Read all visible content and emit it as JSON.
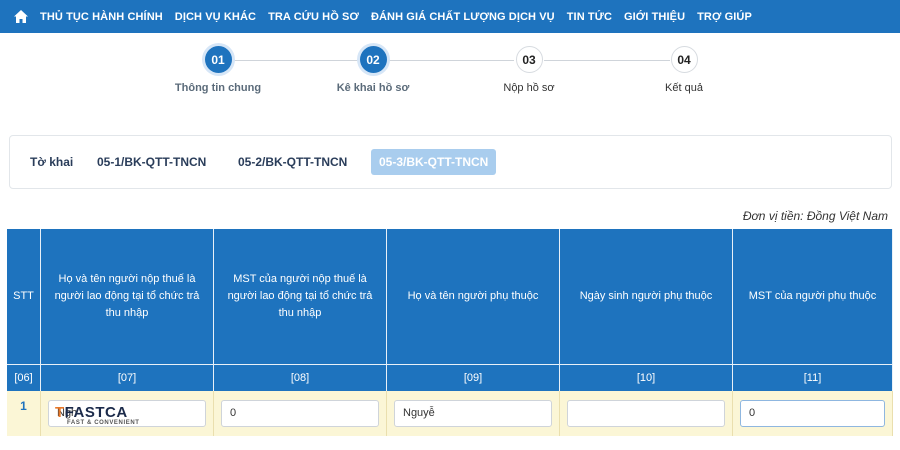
{
  "nav": {
    "items": [
      "THỦ TỤC HÀNH CHÍNH",
      "DỊCH VỤ KHÁC",
      "TRA CỨU HỒ SƠ",
      "ĐÁNH GIÁ CHẤT LƯỢNG DỊCH VỤ",
      "TIN TỨC",
      "GIỚI THIỆU",
      "TRỢ GIÚP"
    ]
  },
  "stepper": {
    "steps": [
      {
        "num": "01",
        "label": "Thông tin chung",
        "state": "active"
      },
      {
        "num": "02",
        "label": "Kê khai hồ sơ",
        "state": "active"
      },
      {
        "num": "03",
        "label": "Nộp hồ sơ",
        "state": "inactive"
      },
      {
        "num": "04",
        "label": "Kết quả",
        "state": "inactive"
      }
    ]
  },
  "tabs": [
    "Tờ khai",
    "05-1/BK-QTT-TNCN",
    "05-2/BK-QTT-TNCN",
    "05-3/BK-QTT-TNCN"
  ],
  "active_tab": "05-3/BK-QTT-TNCN",
  "unit_note": "Đơn vị tiền: Đồng Việt Nam",
  "table": {
    "headers": [
      "STT",
      "Họ và tên người nộp thuế là người lao động tại tổ chức trả thu nhập",
      "MST của người nộp thuế là người lao động tại tổ chức trả thu nhập",
      "Họ và tên người phụ thuộc",
      "Ngày sinh người phụ thuộc",
      "MST của người phụ thuộc"
    ],
    "codes": [
      "[06]",
      "[07]",
      "[08]",
      "[09]",
      "[10]",
      "[11]"
    ],
    "rows": [
      {
        "stt": "1",
        "c07": "Ngh",
        "c08": "0",
        "c09": "Nguyễ",
        "c10": "",
        "c11": "0"
      }
    ]
  },
  "watermark": {
    "brand": "FASTCA",
    "tagline": "FAST & CONVENIENT"
  },
  "colors": {
    "primary": "#1e73be",
    "row_highlight": "#fbf6d6",
    "tab_active": "#a9cdee"
  }
}
